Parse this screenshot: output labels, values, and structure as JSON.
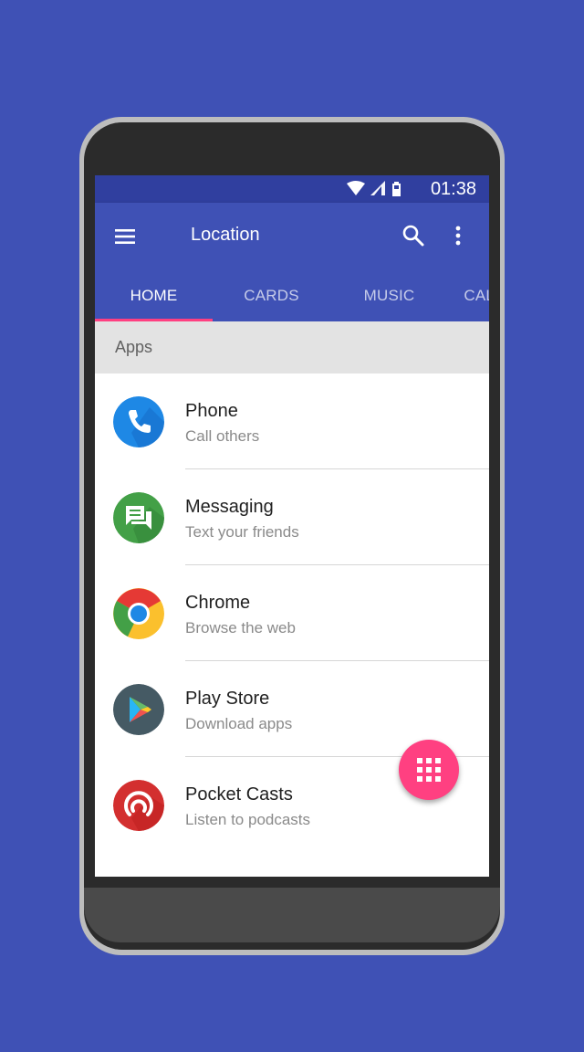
{
  "status_bar": {
    "time": "01:38",
    "icons": [
      "wifi-icon",
      "cell-signal-icon",
      "battery-icon"
    ]
  },
  "toolbar": {
    "title": "Location",
    "icons": [
      "menu-icon",
      "search-icon",
      "more-vert-icon"
    ],
    "color": "#3F51B5",
    "status_color": "#303F9F"
  },
  "tabs": [
    {
      "label": "HOME",
      "active": true
    },
    {
      "label": "CARDS",
      "active": false
    },
    {
      "label": "MUSIC",
      "active": false
    },
    {
      "label": "CALENDAR",
      "active": false
    }
  ],
  "tab_indicator_color": "#FF4081",
  "section": {
    "header": "Apps"
  },
  "apps": [
    {
      "title": "Phone",
      "subtitle": "Call others",
      "icon": "phone-icon",
      "color": "#1E88E5"
    },
    {
      "title": "Messaging",
      "subtitle": "Text your friends",
      "icon": "messaging-icon",
      "color": "#43A047"
    },
    {
      "title": "Chrome",
      "subtitle": "Browse the web",
      "icon": "chrome-icon",
      "color": "#E53935"
    },
    {
      "title": "Play Store",
      "subtitle": "Download apps",
      "icon": "play-store-icon",
      "color": "#455A64"
    },
    {
      "title": "Pocket Casts",
      "subtitle": "Listen to podcasts",
      "icon": "pocket-casts-icon",
      "color": "#D32F2F"
    }
  ],
  "fab": {
    "icon": "apps-grid-icon",
    "color": "#FF4081"
  }
}
